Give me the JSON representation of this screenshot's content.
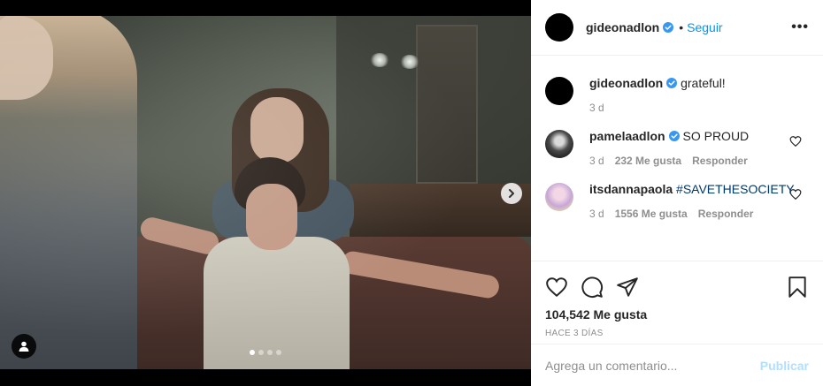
{
  "post": {
    "author": "gideonadlon",
    "follow_label": "Seguir",
    "separator": "•",
    "more_label": "•••"
  },
  "caption": {
    "username": "gideonadlon",
    "text": "grateful!",
    "time": "3 d"
  },
  "comments": [
    {
      "username": "pamelaadlon",
      "text": "SO PROUD",
      "time": "3 d",
      "likes": "232 Me gusta",
      "reply_label": "Responder"
    },
    {
      "username": "itsdannapaola",
      "text": "#SAVETHESOCIETY",
      "time": "3 d",
      "likes": "1556 Me gusta",
      "reply_label": "Responder"
    }
  ],
  "stats": {
    "likes": "104,542 Me gusta",
    "posted": "HACE 3 DÍAS"
  },
  "compose": {
    "placeholder": "Agrega un comentario...",
    "submit_label": "Publicar"
  },
  "carousel": {
    "slide_count": 4,
    "active_index": 0
  },
  "colors": {
    "link_blue": "#0095f6",
    "verified_blue": "#3897f0",
    "hashtag": "#00376b",
    "muted": "#8e8e8e",
    "disabled_blue": "#b2dffc"
  },
  "icons": {
    "verified": "verified-badge-icon",
    "next": "chevron-right-icon",
    "user_tags": "user-icon",
    "like": "heart-icon",
    "comment": "comment-bubble-icon",
    "share": "paper-plane-icon",
    "save": "bookmark-icon",
    "more": "more-options-icon"
  }
}
